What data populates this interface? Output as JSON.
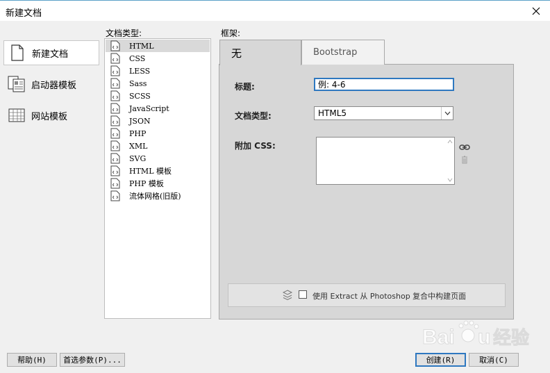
{
  "window": {
    "title": "新建文档"
  },
  "categories": [
    {
      "label": "新建文档",
      "icon": "blank-page-icon",
      "selected": true
    },
    {
      "label": "启动器模板",
      "icon": "starter-template-icon",
      "selected": false
    },
    {
      "label": "网站模板",
      "icon": "site-template-icon",
      "selected": false
    }
  ],
  "doctype_section": {
    "label": "文档类型:",
    "items": [
      "HTML",
      "CSS",
      "LESS",
      "Sass",
      "SCSS",
      "JavaScript",
      "JSON",
      "PHP",
      "XML",
      "SVG",
      "HTML 模板",
      "PHP 模板",
      "流体网格(旧版)"
    ],
    "selected": "HTML"
  },
  "framework": {
    "label": "框架:",
    "tabs": [
      {
        "label": "无",
        "active": true
      },
      {
        "label": "Bootstrap",
        "active": false
      }
    ],
    "fields": {
      "title_label": "标题:",
      "title_value": "例: 4-6",
      "doctype_label": "文档类型:",
      "doctype_value": "HTML5",
      "css_label": "附加 CSS:"
    },
    "extract_label": "使用 Extract 从 Photoshop 复合中构建页面"
  },
  "buttons": {
    "help": "帮助(H)",
    "preferences": "首选参数(P)...",
    "create": "创建(R)",
    "cancel": "取消(C)"
  },
  "watermark": {
    "text": "Baidu 经验"
  },
  "colors": {
    "focus_blue": "#2e78c0",
    "panel_gray": "#d7d7d7"
  }
}
